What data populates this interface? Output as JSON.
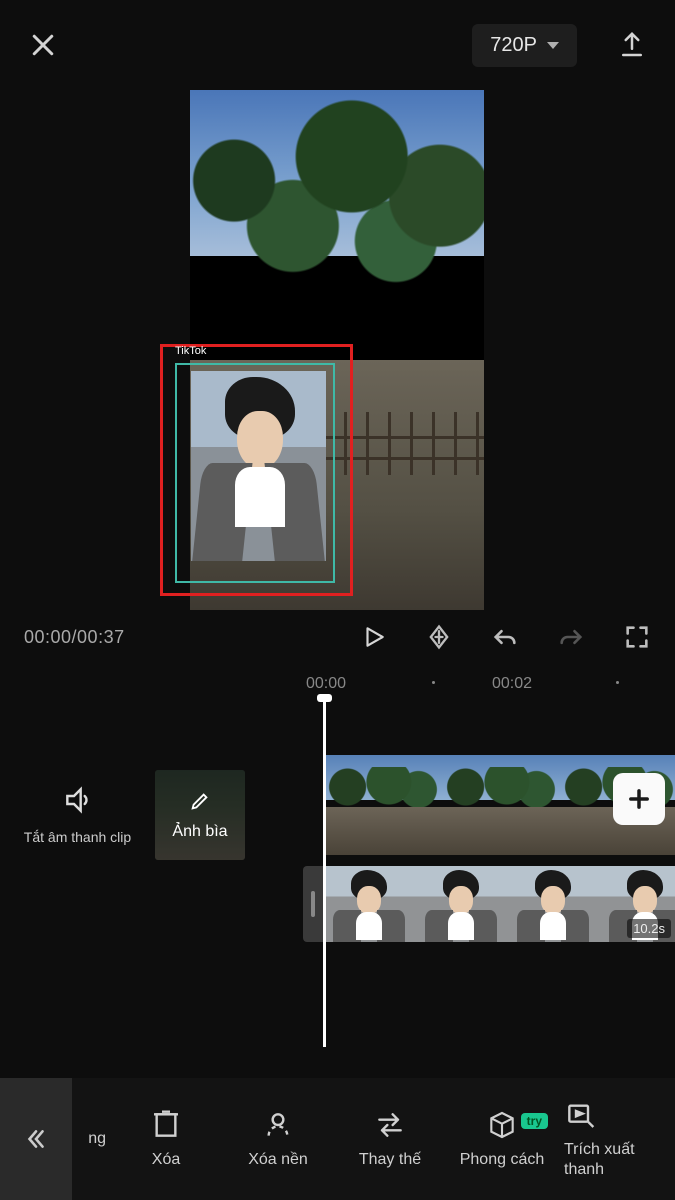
{
  "header": {
    "resolution_label": "720P"
  },
  "preview": {
    "overlay_watermark": "TikTok"
  },
  "controls": {
    "time_display": "00:00/00:37"
  },
  "ruler": {
    "t0": "00:00",
    "t2": "00:02"
  },
  "timeline": {
    "mute_label": "Tắt âm thanh clip",
    "cover_label": "Ảnh bìa",
    "overlay_duration": "10.2s"
  },
  "toolbar": {
    "item_partial_left": "ng",
    "items": [
      {
        "label": "Xóa"
      },
      {
        "label": "Xóa nền"
      },
      {
        "label": "Thay thế"
      },
      {
        "label": "Phong cách",
        "badge": "try"
      }
    ],
    "item_partial_right": "Trích xuất",
    "item_partial_right2": "thanh"
  }
}
